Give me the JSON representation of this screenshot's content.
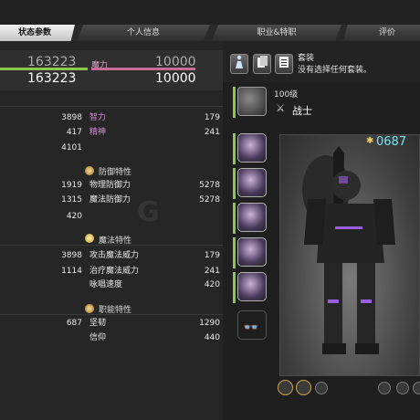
{
  "tabs": [
    {
      "label": "状态参数"
    },
    {
      "label": "个人信息"
    },
    {
      "label": "职业&特职"
    },
    {
      "label": "评价"
    }
  ],
  "vitals": {
    "hp_current": "163223",
    "hp_max": "163223",
    "mp_label": "魔力",
    "mp_current": "10000",
    "mp_max": "10000"
  },
  "attributes": [
    {
      "left_value": "3898",
      "right_label": "智力",
      "right_value": "179"
    },
    {
      "left_value": "417",
      "right_label": "精神",
      "right_value": "241"
    },
    {
      "left_value": "4101"
    }
  ],
  "defense": {
    "title": "防御特性",
    "rows": [
      {
        "left_value": "1919",
        "right_label": "物理防御力",
        "right_value": "5278"
      },
      {
        "left_value": "1315",
        "right_label": "魔法防御力",
        "right_value": "5278"
      },
      {
        "left_value": "420"
      }
    ]
  },
  "magic": {
    "title": "魔法特性",
    "rows": [
      {
        "left_value": "3898",
        "right_label": "攻击魔法威力",
        "right_value": "179"
      },
      {
        "left_value": "1114",
        "right_label": "治疗魔法威力",
        "right_value": "241"
      },
      {
        "right_label": "咏唱速度",
        "right_value": "420"
      }
    ]
  },
  "role": {
    "title": "职能特性",
    "rows": [
      {
        "left_value": "687",
        "right_label": "坚韧",
        "right_value": "1290"
      },
      {
        "right_label": "信仰",
        "right_value": "440"
      }
    ]
  },
  "gearset": {
    "title": "套装",
    "description": "没有选择任何套装。"
  },
  "job": {
    "level": "100级",
    "name": "战士",
    "item_level": "0687"
  },
  "watermark": "G",
  "icons": [
    "equip-icon",
    "cards-icon",
    "list-icon",
    "warrior-job-icon",
    "star-icon",
    "glasses-icon",
    "weapon-icon",
    "eye-icon"
  ],
  "colors": {
    "hp_bar": "#8cc84b",
    "mp_bar": "#c86a9a",
    "item_level": "#7de0f0",
    "active_tab": "#e6e6e6"
  }
}
